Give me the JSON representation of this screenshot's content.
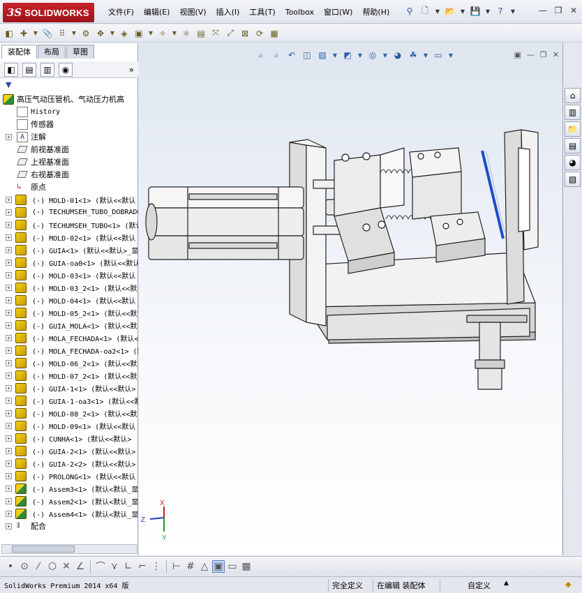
{
  "app": {
    "logo_ds": "3S",
    "logo_name": "SOLIDWORKS"
  },
  "menu": [
    {
      "label": "文件(F)"
    },
    {
      "label": "编辑(E)"
    },
    {
      "label": "视图(V)"
    },
    {
      "label": "插入(I)"
    },
    {
      "label": "工具(T)"
    },
    {
      "label": "Toolbox"
    },
    {
      "label": "窗口(W)"
    },
    {
      "label": "帮助(H)"
    }
  ],
  "panel": {
    "tabs": [
      {
        "label": "装配体"
      },
      {
        "label": "布局"
      },
      {
        "label": "草图"
      }
    ],
    "more": "»"
  },
  "tree": {
    "root": "高压气动压管机、气动压力机高",
    "features": [
      {
        "label": "History"
      },
      {
        "label": "传感器"
      },
      {
        "label": "注解"
      },
      {
        "label": "前视基准面"
      },
      {
        "label": "上视基准面"
      },
      {
        "label": "右视基准面"
      },
      {
        "label": "原点"
      }
    ],
    "parts": [
      {
        "label": "(-) MOLD-01<1> (默认<<默认"
      },
      {
        "label": "(-) TECHUMSEH_TUBO_DOBRADO"
      },
      {
        "label": "(-) TECHUMSEH_TUBO<1> (默认"
      },
      {
        "label": "(-) MOLD-02<1> (默认<<默认"
      },
      {
        "label": "(-) GUIA<1> (默认<<默认>_显"
      },
      {
        "label": "(-) GUIA-oa0<1> (默认<<默认"
      },
      {
        "label": "(-) MOLD-03<1> (默认<<默认"
      },
      {
        "label": "(-) MOLD-03_2<1> (默认<<默"
      },
      {
        "label": "(-) MOLD-04<1> (默认<<默认"
      },
      {
        "label": "(-) MOLD-05_2<1> (默认<<默"
      },
      {
        "label": "(-) GUIA_MOLA<1> (默认<<默"
      },
      {
        "label": "(-) MOLA_FECHADA<1> (默认<"
      },
      {
        "label": "(-) MOLA_FECHADA-oa2<1> (默"
      },
      {
        "label": "(-) MOLD-06_2<1> (默认<<默"
      },
      {
        "label": "(-) MOLD-07_2<1> (默认<<默"
      },
      {
        "label": "(-) GUIA-1<1> (默认<<默认>"
      },
      {
        "label": "(-) GUIA-1-oa3<1> (默认<<默"
      },
      {
        "label": "(-) MOLD-08_2<1> (默认<<默"
      },
      {
        "label": "(-) MOLD-09<1> (默认<<默认"
      },
      {
        "label": "(-) CUNHA<1> (默认<<默认>"
      },
      {
        "label": "(-) GUIA-2<1> (默认<<默认>"
      },
      {
        "label": "(-) GUIA-2<2> (默认<<默认>"
      },
      {
        "label": "(-) PROLONG<1> (默认<<默认"
      },
      {
        "label": "(-) Assem3<1> (默认<默认_显"
      },
      {
        "label": "(-) Assem2<1> (默认<默认_显"
      },
      {
        "label": "(-) Assem4<1> (默认<默认_显"
      }
    ],
    "mates": "配合"
  },
  "triad": {
    "x": "X",
    "y": "Y",
    "z": "Z"
  },
  "status": {
    "product": "SolidWorks Premium 2014 x64 版",
    "definition": "完全定义",
    "mode": "在编辑 装配体",
    "units": "自定义",
    "arrow": "▲"
  },
  "colors": {
    "accent": "#2b5ea8",
    "logo_red": "#c9232c",
    "part_yellow": "#f3d21b"
  }
}
